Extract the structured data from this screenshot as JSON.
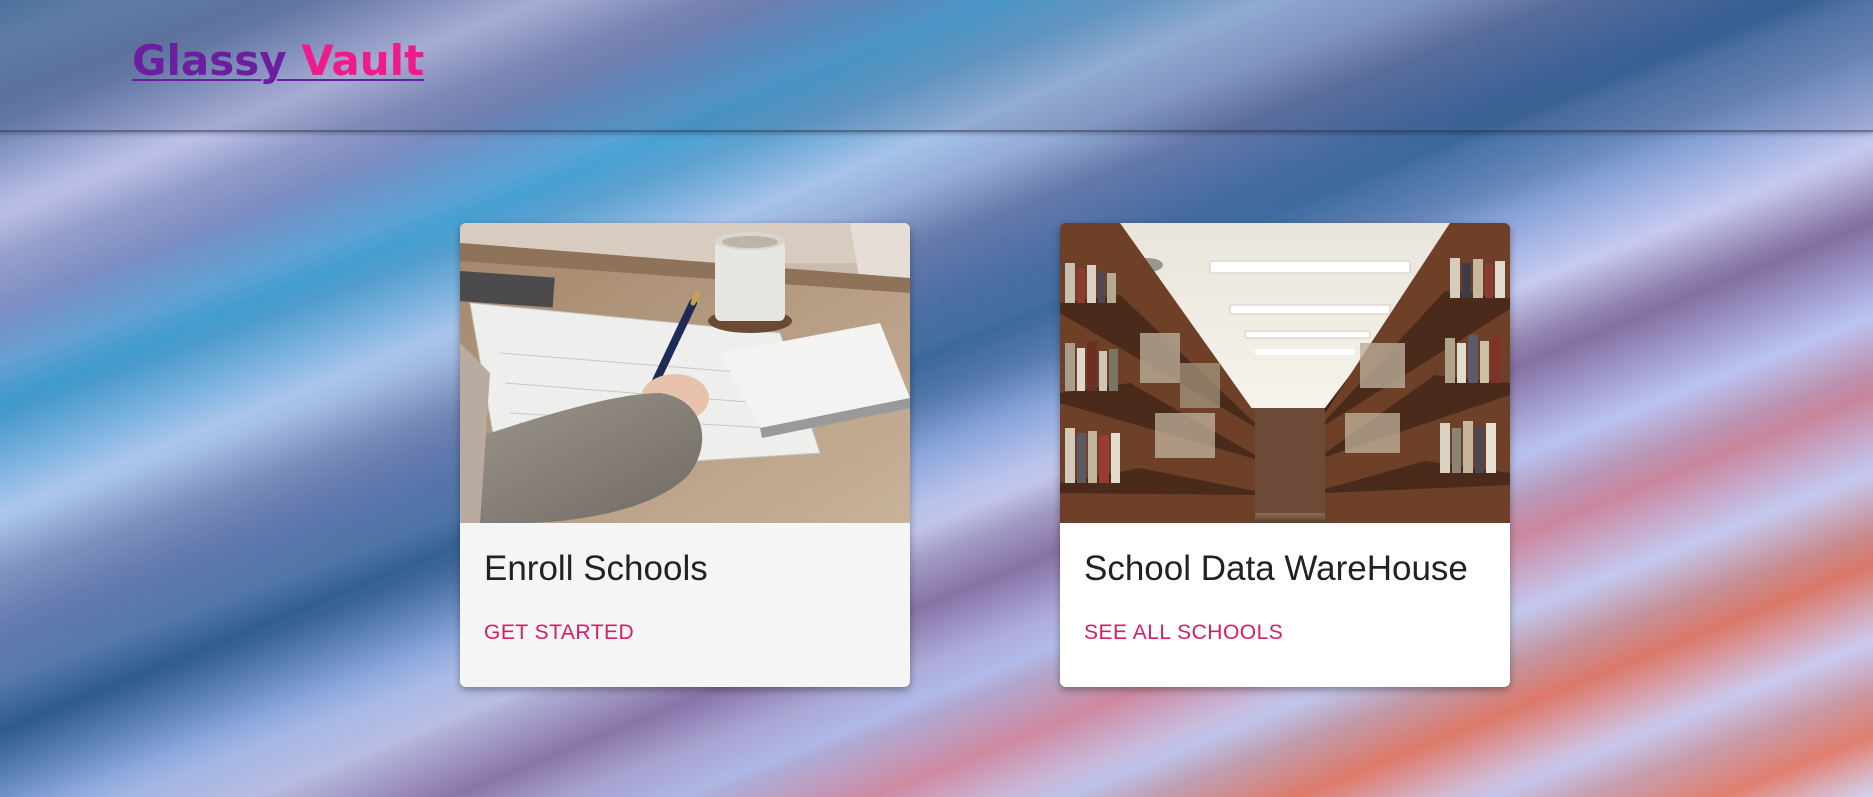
{
  "header": {
    "logo_word1": "Glassy",
    "logo_word2": "Vault"
  },
  "cards": [
    {
      "title": "Enroll Schools",
      "action_label": "GET STARTED",
      "image": "desk-writing-photo"
    },
    {
      "title": "School Data WareHouse",
      "action_label": "SEE ALL SCHOOLS",
      "image": "library-aisle-photo"
    }
  ],
  "colors": {
    "logo_purple": "#6b1fa0",
    "logo_pink": "#ef1a8c",
    "action_pink": "#d81b6a",
    "card_background": "#f5f5f5"
  }
}
